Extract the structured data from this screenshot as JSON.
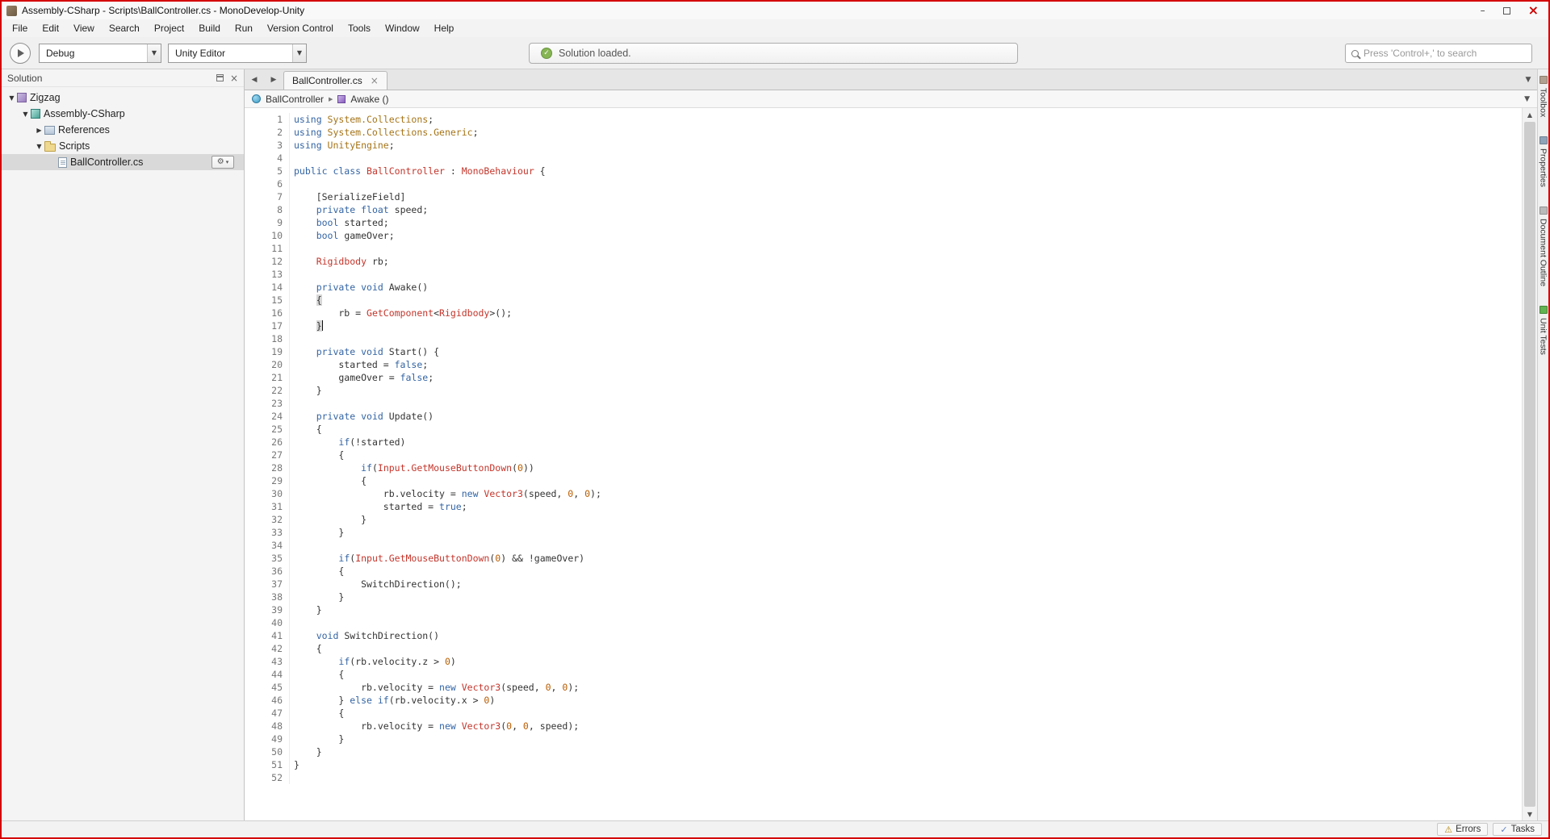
{
  "window": {
    "title": "Assembly-CSharp - Scripts\\BallController.cs - MonoDevelop-Unity",
    "border_color": "#d40000",
    "controls": [
      "minimize",
      "maximize",
      "close"
    ]
  },
  "menu": {
    "items": [
      "File",
      "Edit",
      "View",
      "Search",
      "Project",
      "Build",
      "Run",
      "Version Control",
      "Tools",
      "Window",
      "Help"
    ]
  },
  "toolbar": {
    "run_button_icon": "play-icon",
    "debug_dropdown": "Debug",
    "target_dropdown": "Unity Editor",
    "status_icon": "check-circle-icon",
    "status_message": "Solution loaded.",
    "search_icon": "search-icon",
    "search_placeholder": "Press 'Control+,' to search"
  },
  "solution_pad": {
    "title": "Solution",
    "tree": [
      {
        "label": "Zigzag",
        "level": 0,
        "expander": "open",
        "icon": "solution-icon"
      },
      {
        "label": "Assembly-CSharp",
        "level": 1,
        "expander": "open",
        "icon": "project-icon"
      },
      {
        "label": "References",
        "level": 2,
        "expander": "closed",
        "icon": "references-icon"
      },
      {
        "label": "Scripts",
        "level": 2,
        "expander": "open",
        "icon": "folder-icon"
      },
      {
        "label": "BallController.cs",
        "level": 3,
        "expander": "none",
        "icon": "csfile-icon",
        "selected": true
      }
    ]
  },
  "editor": {
    "tab": "BallController.cs",
    "breadcrumb": [
      "BallController",
      "Awake ()"
    ],
    "caret_line": 17,
    "syntax_colors": {
      "keyword": "#3465a4",
      "type": "#c3352b",
      "namespace": "#a57417",
      "number": "#b85c00",
      "plain": "#333333"
    },
    "lines": [
      {
        "n": 1,
        "s": [
          [
            "using ",
            "k"
          ],
          [
            "System.Collections",
            "n"
          ],
          [
            ";",
            "p"
          ]
        ]
      },
      {
        "n": 2,
        "s": [
          [
            "using ",
            "k"
          ],
          [
            "System.Collections.Generic",
            "n"
          ],
          [
            ";",
            "p"
          ]
        ]
      },
      {
        "n": 3,
        "s": [
          [
            "using ",
            "k"
          ],
          [
            "UnityEngine",
            "n"
          ],
          [
            ";",
            "p"
          ]
        ]
      },
      {
        "n": 4,
        "s": []
      },
      {
        "n": 5,
        "s": [
          [
            "public class ",
            "k"
          ],
          [
            "BallController",
            "t"
          ],
          [
            " : ",
            "p"
          ],
          [
            "MonoBehaviour",
            "t"
          ],
          [
            " {",
            "p"
          ]
        ]
      },
      {
        "n": 6,
        "s": []
      },
      {
        "n": 7,
        "s": [
          [
            "    [SerializeField]",
            "p"
          ]
        ]
      },
      {
        "n": 8,
        "s": [
          [
            "    ",
            "p"
          ],
          [
            "private float ",
            "k"
          ],
          [
            "speed;",
            "p"
          ]
        ]
      },
      {
        "n": 9,
        "s": [
          [
            "    ",
            "p"
          ],
          [
            "bool ",
            "k"
          ],
          [
            "started;",
            "p"
          ]
        ]
      },
      {
        "n": 10,
        "s": [
          [
            "    ",
            "p"
          ],
          [
            "bool ",
            "k"
          ],
          [
            "gameOver;",
            "p"
          ]
        ]
      },
      {
        "n": 11,
        "s": []
      },
      {
        "n": 12,
        "s": [
          [
            "    ",
            "p"
          ],
          [
            "Rigidbody",
            "t"
          ],
          [
            " rb;",
            "p"
          ]
        ]
      },
      {
        "n": 13,
        "s": []
      },
      {
        "n": 14,
        "s": [
          [
            "    ",
            "p"
          ],
          [
            "private void ",
            "k"
          ],
          [
            "Awake()",
            "p"
          ]
        ]
      },
      {
        "n": 15,
        "s": [
          [
            "    ",
            "p"
          ],
          [
            "{",
            "b"
          ]
        ]
      },
      {
        "n": 16,
        "s": [
          [
            "        rb = ",
            "p"
          ],
          [
            "GetComponent",
            "t"
          ],
          [
            "<",
            "p"
          ],
          [
            "Rigidbody",
            "t"
          ],
          [
            ">();",
            "p"
          ]
        ]
      },
      {
        "n": 17,
        "s": [
          [
            "    ",
            "p"
          ],
          [
            "}",
            "b"
          ]
        ]
      },
      {
        "n": 18,
        "s": []
      },
      {
        "n": 19,
        "s": [
          [
            "    ",
            "p"
          ],
          [
            "private void ",
            "k"
          ],
          [
            "Start() {",
            "p"
          ]
        ]
      },
      {
        "n": 20,
        "s": [
          [
            "        started = ",
            "p"
          ],
          [
            "false",
            "k"
          ],
          [
            ";",
            "p"
          ]
        ]
      },
      {
        "n": 21,
        "s": [
          [
            "        gameOver = ",
            "p"
          ],
          [
            "false",
            "k"
          ],
          [
            ";",
            "p"
          ]
        ]
      },
      {
        "n": 22,
        "s": [
          [
            "    }",
            "p"
          ]
        ]
      },
      {
        "n": 23,
        "s": []
      },
      {
        "n": 24,
        "s": [
          [
            "    ",
            "p"
          ],
          [
            "private void ",
            "k"
          ],
          [
            "Update()",
            "p"
          ]
        ]
      },
      {
        "n": 25,
        "s": [
          [
            "    {",
            "p"
          ]
        ]
      },
      {
        "n": 26,
        "s": [
          [
            "        ",
            "p"
          ],
          [
            "if",
            "k"
          ],
          [
            "(!started)",
            "p"
          ]
        ]
      },
      {
        "n": 27,
        "s": [
          [
            "        {",
            "p"
          ]
        ]
      },
      {
        "n": 28,
        "s": [
          [
            "            ",
            "p"
          ],
          [
            "if",
            "k"
          ],
          [
            "(",
            "p"
          ],
          [
            "Input.GetMouseButtonDown",
            "t"
          ],
          [
            "(",
            "p"
          ],
          [
            "0",
            "m"
          ],
          [
            "))",
            "p"
          ]
        ]
      },
      {
        "n": 29,
        "s": [
          [
            "            {",
            "p"
          ]
        ]
      },
      {
        "n": 30,
        "s": [
          [
            "                rb.velocity = ",
            "p"
          ],
          [
            "new ",
            "k"
          ],
          [
            "Vector3",
            "t"
          ],
          [
            "(speed, ",
            "p"
          ],
          [
            "0",
            "m"
          ],
          [
            ", ",
            "p"
          ],
          [
            "0",
            "m"
          ],
          [
            ");",
            "p"
          ]
        ]
      },
      {
        "n": 31,
        "s": [
          [
            "                started = ",
            "p"
          ],
          [
            "true",
            "k"
          ],
          [
            ";",
            "p"
          ]
        ]
      },
      {
        "n": 32,
        "s": [
          [
            "            }",
            "p"
          ]
        ]
      },
      {
        "n": 33,
        "s": [
          [
            "        }",
            "p"
          ]
        ]
      },
      {
        "n": 34,
        "s": []
      },
      {
        "n": 35,
        "s": [
          [
            "        ",
            "p"
          ],
          [
            "if",
            "k"
          ],
          [
            "(",
            "p"
          ],
          [
            "Input.GetMouseButtonDown",
            "t"
          ],
          [
            "(",
            "p"
          ],
          [
            "0",
            "m"
          ],
          [
            ") && !gameOver)",
            "p"
          ]
        ]
      },
      {
        "n": 36,
        "s": [
          [
            "        {",
            "p"
          ]
        ]
      },
      {
        "n": 37,
        "s": [
          [
            "            SwitchDirection();",
            "p"
          ]
        ]
      },
      {
        "n": 38,
        "s": [
          [
            "        }",
            "p"
          ]
        ]
      },
      {
        "n": 39,
        "s": [
          [
            "    }",
            "p"
          ]
        ]
      },
      {
        "n": 40,
        "s": []
      },
      {
        "n": 41,
        "s": [
          [
            "    ",
            "p"
          ],
          [
            "void ",
            "k"
          ],
          [
            "SwitchDirection()",
            "p"
          ]
        ]
      },
      {
        "n": 42,
        "s": [
          [
            "    {",
            "p"
          ]
        ]
      },
      {
        "n": 43,
        "s": [
          [
            "        ",
            "p"
          ],
          [
            "if",
            "k"
          ],
          [
            "(rb.velocity.z > ",
            "p"
          ],
          [
            "0",
            "m"
          ],
          [
            ")",
            "p"
          ]
        ]
      },
      {
        "n": 44,
        "s": [
          [
            "        {",
            "p"
          ]
        ]
      },
      {
        "n": 45,
        "s": [
          [
            "            rb.velocity = ",
            "p"
          ],
          [
            "new ",
            "k"
          ],
          [
            "Vector3",
            "t"
          ],
          [
            "(speed, ",
            "p"
          ],
          [
            "0",
            "m"
          ],
          [
            ", ",
            "p"
          ],
          [
            "0",
            "m"
          ],
          [
            ");",
            "p"
          ]
        ]
      },
      {
        "n": 46,
        "s": [
          [
            "        } ",
            "p"
          ],
          [
            "else if",
            "k"
          ],
          [
            "(rb.velocity.x > ",
            "p"
          ],
          [
            "0",
            "m"
          ],
          [
            ")",
            "p"
          ]
        ]
      },
      {
        "n": 47,
        "s": [
          [
            "        {",
            "p"
          ]
        ]
      },
      {
        "n": 48,
        "s": [
          [
            "            rb.velocity = ",
            "p"
          ],
          [
            "new ",
            "k"
          ],
          [
            "Vector3",
            "t"
          ],
          [
            "(",
            "p"
          ],
          [
            "0",
            "m"
          ],
          [
            ", ",
            "p"
          ],
          [
            "0",
            "m"
          ],
          [
            ", speed);",
            "p"
          ]
        ]
      },
      {
        "n": 49,
        "s": [
          [
            "        }",
            "p"
          ]
        ]
      },
      {
        "n": 50,
        "s": [
          [
            "    }",
            "p"
          ]
        ]
      },
      {
        "n": 51,
        "s": [
          [
            "}",
            "p"
          ]
        ]
      },
      {
        "n": 52,
        "s": []
      }
    ]
  },
  "right_tabs": [
    {
      "label": "Toolbox",
      "icon": "toolbox-icon"
    },
    {
      "label": "Properties",
      "icon": "properties-icon"
    },
    {
      "label": "Document Outline",
      "icon": "document-outline-icon"
    },
    {
      "label": "Unit Tests",
      "icon": "unit-tests-icon"
    }
  ],
  "status_bar": {
    "errors_label": "Errors",
    "tasks_label": "Tasks"
  }
}
